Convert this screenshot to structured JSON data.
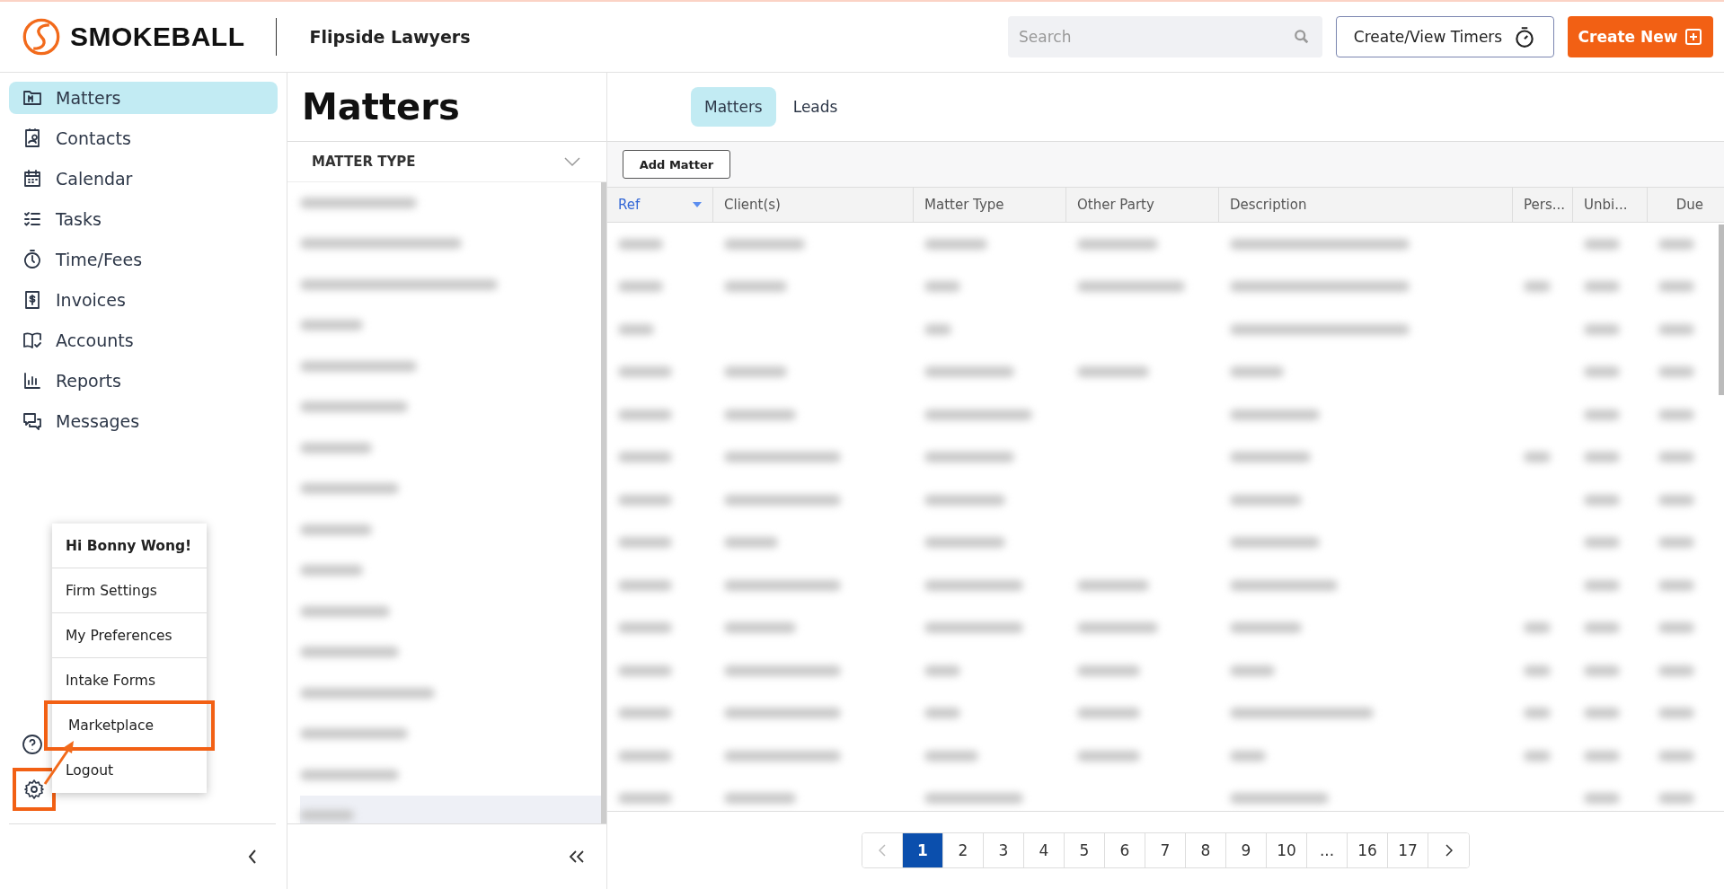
{
  "header": {
    "brand": "SMOKEBALL",
    "firm": "Flipside Lawyers",
    "search": {
      "placeholder": "Search"
    },
    "timers_button": "Create/View Timers",
    "create_button": "Create New"
  },
  "sidebar": {
    "items": [
      {
        "label": "Matters",
        "selected": true
      },
      {
        "label": "Contacts",
        "selected": false
      },
      {
        "label": "Calendar",
        "selected": false
      },
      {
        "label": "Tasks",
        "selected": false
      },
      {
        "label": "Time/Fees",
        "selected": false
      },
      {
        "label": "Invoices",
        "selected": false
      },
      {
        "label": "Accounts",
        "selected": false
      },
      {
        "label": "Reports",
        "selected": false
      },
      {
        "label": "Messages",
        "selected": false
      }
    ]
  },
  "user_menu": {
    "greeting": "Hi Bonny Wong!",
    "items": [
      {
        "label": "Firm Settings",
        "highlighted": false
      },
      {
        "label": "My Preferences",
        "highlighted": false
      },
      {
        "label": "Intake Forms",
        "highlighted": false
      },
      {
        "label": "Marketplace",
        "highlighted": true
      },
      {
        "label": "Logout",
        "highlighted": false
      }
    ]
  },
  "page": {
    "title": "Matters",
    "tabs": [
      {
        "label": "Matters",
        "selected": true
      },
      {
        "label": "Leads",
        "selected": false
      }
    ]
  },
  "filter": {
    "heading": "MATTER TYPE"
  },
  "table": {
    "add_button": "Add Matter",
    "columns": [
      {
        "label": "Ref",
        "sorted": true
      },
      {
        "label": "Client(s)",
        "sorted": false
      },
      {
        "label": "Matter Type",
        "sorted": false
      },
      {
        "label": "Other Party",
        "sorted": false
      },
      {
        "label": "Description",
        "sorted": false
      },
      {
        "label": "Pers...",
        "sorted": false
      },
      {
        "label": "Unbi...",
        "sorted": false
      },
      {
        "label": "Due",
        "sorted": false
      }
    ]
  },
  "pagination": {
    "pages": [
      {
        "label": "1",
        "selected": true
      },
      {
        "label": "2",
        "selected": false
      },
      {
        "label": "3",
        "selected": false
      },
      {
        "label": "4",
        "selected": false
      },
      {
        "label": "5",
        "selected": false
      },
      {
        "label": "6",
        "selected": false
      },
      {
        "label": "7",
        "selected": false
      },
      {
        "label": "8",
        "selected": false
      },
      {
        "label": "9",
        "selected": false
      },
      {
        "label": "10",
        "selected": false
      },
      {
        "label": "...",
        "selected": false
      },
      {
        "label": "16",
        "selected": false
      },
      {
        "label": "17",
        "selected": false
      }
    ]
  }
}
